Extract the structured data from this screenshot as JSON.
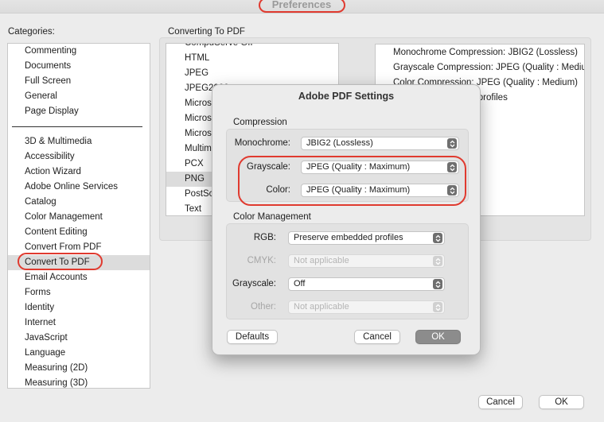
{
  "window": {
    "title": "Preferences"
  },
  "categories": {
    "header": "Categories:",
    "top_items": [
      "Commenting",
      "Documents",
      "Full Screen",
      "General",
      "Page Display"
    ],
    "items": [
      "3D & Multimedia",
      "Accessibility",
      "Action Wizard",
      "Adobe Online Services",
      "Catalog",
      "Color Management",
      "Content Editing",
      "Convert From PDF",
      "Convert To PDF",
      "Email Accounts",
      "Forms",
      "Identity",
      "Internet",
      "JavaScript",
      "Language",
      "Measuring (2D)",
      "Measuring (3D)"
    ],
    "selected": "Convert To PDF"
  },
  "converting": {
    "header": "Converting To PDF",
    "formats": [
      "CompuServe GIF",
      "HTML",
      "JPEG",
      "JPEG2000",
      "Microsoft",
      "Microsoft",
      "Microsoft",
      "Multimedia",
      "PCX",
      "PNG",
      "PostScript",
      "Text"
    ],
    "selected": "PNG",
    "settings": [
      "Monochrome Compression: JBIG2 (Lossless)",
      "Grayscale Compression: JPEG (Quality : Medium)",
      "Color Compression: JPEG (Quality : Medium)",
      "Preserve embedded profiles"
    ]
  },
  "dialog": {
    "title": "Adobe PDF Settings",
    "compression": {
      "label": "Compression",
      "monochrome_label": "Monochrome:",
      "monochrome_value": "JBIG2 (Lossless)",
      "grayscale_label": "Grayscale:",
      "grayscale_value": "JPEG (Quality : Maximum)",
      "color_label": "Color:",
      "color_value": "JPEG (Quality : Maximum)"
    },
    "color_management": {
      "label": "Color Management",
      "rgb_label": "RGB:",
      "rgb_value": "Preserve embedded profiles",
      "cmyk_label": "CMYK:",
      "cmyk_value": "Not applicable",
      "grayscale_label": "Grayscale:",
      "grayscale_value": "Off",
      "other_label": "Other:",
      "other_value": "Not applicable"
    },
    "buttons": {
      "defaults": "Defaults",
      "cancel": "Cancel",
      "ok": "OK"
    }
  },
  "footer": {
    "cancel": "Cancel",
    "ok": "OK"
  },
  "colors": {
    "highlight_ring": "#e03a2f",
    "selected_row": "#dcdcdc",
    "primary_button": "#8c8c8c"
  }
}
